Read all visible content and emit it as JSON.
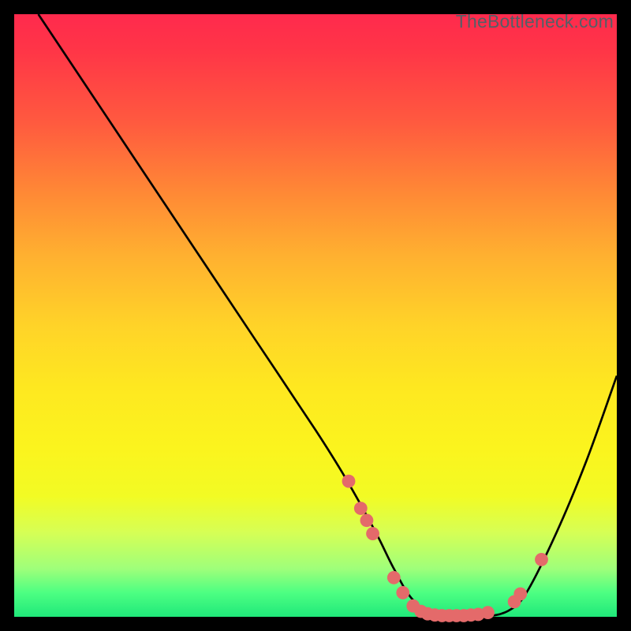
{
  "watermark": "TheBottleneck.com",
  "chart_data": {
    "type": "line",
    "title": "",
    "xlabel": "",
    "ylabel": "",
    "xlim": [
      0,
      100
    ],
    "ylim": [
      0,
      100
    ],
    "grid": false,
    "legend": false,
    "series": [
      {
        "name": "bottleneck-curve",
        "color": "#000000",
        "x": [
          4,
          10,
          20,
          30,
          40,
          50,
          55,
          60,
          63,
          66,
          70,
          74,
          78,
          82,
          85,
          90,
          95,
          100
        ],
        "y": [
          100,
          91,
          76,
          61,
          46,
          31,
          23,
          14,
          8,
          3,
          0,
          0,
          0,
          1,
          4,
          14,
          26,
          40
        ]
      }
    ],
    "markers": [
      {
        "x": 55.5,
        "y": 22.5,
        "r": 1.1
      },
      {
        "x": 57.5,
        "y": 18.0,
        "r": 1.1
      },
      {
        "x": 58.5,
        "y": 16.0,
        "r": 1.1
      },
      {
        "x": 59.5,
        "y": 13.8,
        "r": 1.1
      },
      {
        "x": 63.0,
        "y": 6.5,
        "r": 1.1
      },
      {
        "x": 64.5,
        "y": 4.0,
        "r": 1.1
      },
      {
        "x": 66.2,
        "y": 1.8,
        "r": 1.1
      },
      {
        "x": 67.5,
        "y": 0.9,
        "r": 1.1
      },
      {
        "x": 68.6,
        "y": 0.5,
        "r": 1.1
      },
      {
        "x": 69.8,
        "y": 0.3,
        "r": 1.1
      },
      {
        "x": 71.0,
        "y": 0.2,
        "r": 1.1
      },
      {
        "x": 72.2,
        "y": 0.2,
        "r": 1.1
      },
      {
        "x": 73.4,
        "y": 0.2,
        "r": 1.1
      },
      {
        "x": 74.6,
        "y": 0.2,
        "r": 1.1
      },
      {
        "x": 75.8,
        "y": 0.3,
        "r": 1.1
      },
      {
        "x": 77.0,
        "y": 0.4,
        "r": 1.1
      },
      {
        "x": 78.6,
        "y": 0.7,
        "r": 1.1
      },
      {
        "x": 83.0,
        "y": 2.5,
        "r": 1.1
      },
      {
        "x": 84.0,
        "y": 3.8,
        "r": 1.1
      },
      {
        "x": 87.5,
        "y": 9.5,
        "r": 1.1
      }
    ],
    "marker_color": "#e46a6a",
    "gradient_stops": [
      {
        "pct": 0,
        "color": "#ff2a4d"
      },
      {
        "pct": 6,
        "color": "#ff3547"
      },
      {
        "pct": 18,
        "color": "#ff5a3f"
      },
      {
        "pct": 30,
        "color": "#ff8a35"
      },
      {
        "pct": 40,
        "color": "#ffb030"
      },
      {
        "pct": 52,
        "color": "#ffd428"
      },
      {
        "pct": 62,
        "color": "#fee820"
      },
      {
        "pct": 72,
        "color": "#fbf41e"
      },
      {
        "pct": 80,
        "color": "#f2fb24"
      },
      {
        "pct": 86,
        "color": "#d6ff55"
      },
      {
        "pct": 92,
        "color": "#9fff7a"
      },
      {
        "pct": 96,
        "color": "#4dff82"
      },
      {
        "pct": 100,
        "color": "#20e87a"
      }
    ]
  }
}
